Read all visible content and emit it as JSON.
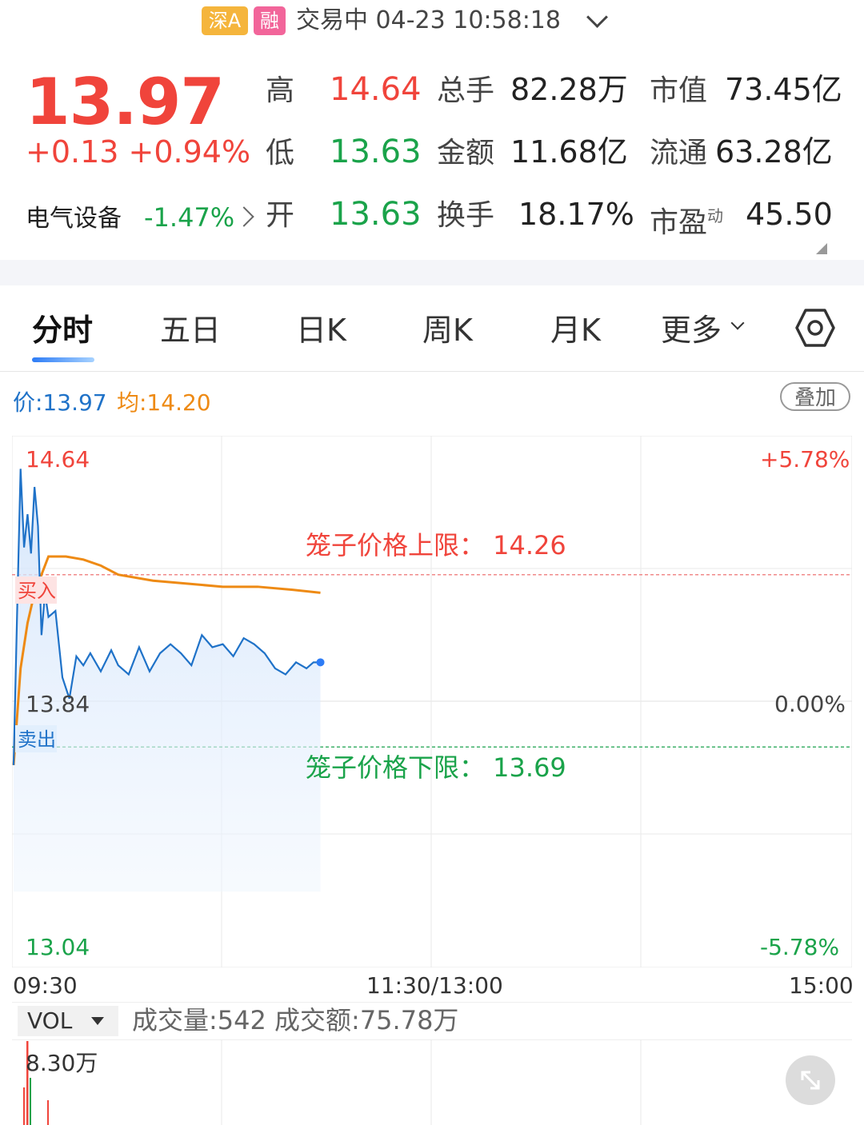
{
  "header": {
    "market_tag": "深A",
    "margin_tag": "融",
    "status": "交易中 04-23 10:58:18"
  },
  "quote": {
    "price": "13.97",
    "change": "+0.13 +0.94%",
    "sector_name": "电气设备",
    "sector_change": "-1.47%",
    "rows": [
      {
        "l1": "高",
        "v1": "14.64",
        "l2": "总手",
        "v2": "82.28万",
        "l3": "市值",
        "v3": "73.45亿"
      },
      {
        "l1": "低",
        "v1": "13.63",
        "l2": "金额",
        "v2": "11.68亿",
        "l3": "流通",
        "v3": "63.28亿"
      },
      {
        "l1": "开",
        "v1": "13.63",
        "l2": "换手",
        "v2": "18.17%",
        "l3": "市盈",
        "l3_sup": "动",
        "v3": "45.50"
      }
    ]
  },
  "tabs": [
    "分时",
    "五日",
    "日K",
    "周K",
    "月K",
    "更多"
  ],
  "chart_info": {
    "price": "价:13.97",
    "avg": "均:14.20",
    "overlay": "叠加"
  },
  "chart_labels": {
    "high": "14.64",
    "pre_close": "13.84",
    "low": "13.04",
    "pct_high": "+5.78%",
    "pct_zero": "0.00%",
    "pct_low": "-5.78%",
    "cage_upper": "笼子价格上限：  14.26",
    "cage_lower": "笼子价格下限：  13.69",
    "buy": "买入",
    "sell": "卖出",
    "time_start": "09:30",
    "time_mid": "11:30/13:00",
    "time_end": "15:00"
  },
  "volume": {
    "selector": "VOL",
    "info": "成交量:542 成交额:75.78万",
    "max": "8.30万"
  },
  "colors": {
    "up": "#f0443b",
    "down": "#1aa34a",
    "price_line": "#1f72c8",
    "avg_line": "#ee8a14"
  },
  "chart_data": {
    "type": "line",
    "ylim": [
      13.04,
      14.64
    ],
    "reference": 13.84,
    "x_range": [
      "09:30",
      "15:00"
    ],
    "series": [
      {
        "name": "价",
        "x": [
          "09:30",
          "09:31",
          "09:32",
          "09:33",
          "09:34",
          "09:35",
          "09:36",
          "09:37",
          "09:38",
          "09:39",
          "09:40",
          "09:42",
          "09:44",
          "09:46",
          "09:48",
          "09:50",
          "09:52",
          "09:55",
          "09:58",
          "10:00",
          "10:03",
          "10:06",
          "10:09",
          "10:12",
          "10:15",
          "10:18",
          "10:21",
          "10:24",
          "10:27",
          "10:30",
          "10:33",
          "10:36",
          "10:39",
          "10:42",
          "10:45",
          "10:48",
          "10:51",
          "10:54",
          "10:56",
          "10:58"
        ],
        "values": [
          13.63,
          14.13,
          14.61,
          14.35,
          14.46,
          14.33,
          14.55,
          14.42,
          14.06,
          14.2,
          14.12,
          14.14,
          13.92,
          13.85,
          13.99,
          13.96,
          14.0,
          13.94,
          14.01,
          13.96,
          13.93,
          14.02,
          13.94,
          14.0,
          14.03,
          14.0,
          13.96,
          14.06,
          14.02,
          14.03,
          13.99,
          14.05,
          14.03,
          14.0,
          13.95,
          13.93,
          13.97,
          13.95,
          13.97,
          13.97
        ]
      },
      {
        "name": "均",
        "x": [
          "09:30",
          "09:32",
          "09:34",
          "09:36",
          "09:38",
          "09:40",
          "09:45",
          "09:50",
          "09:55",
          "10:00",
          "10:10",
          "10:20",
          "10:30",
          "10:40",
          "10:50",
          "10:58"
        ],
        "values": [
          13.63,
          13.95,
          14.1,
          14.2,
          14.26,
          14.32,
          14.32,
          14.31,
          14.29,
          14.26,
          14.24,
          14.23,
          14.22,
          14.22,
          14.21,
          14.2
        ]
      }
    ],
    "lines": {
      "cage_upper": 14.26,
      "cage_lower": 13.69
    }
  }
}
